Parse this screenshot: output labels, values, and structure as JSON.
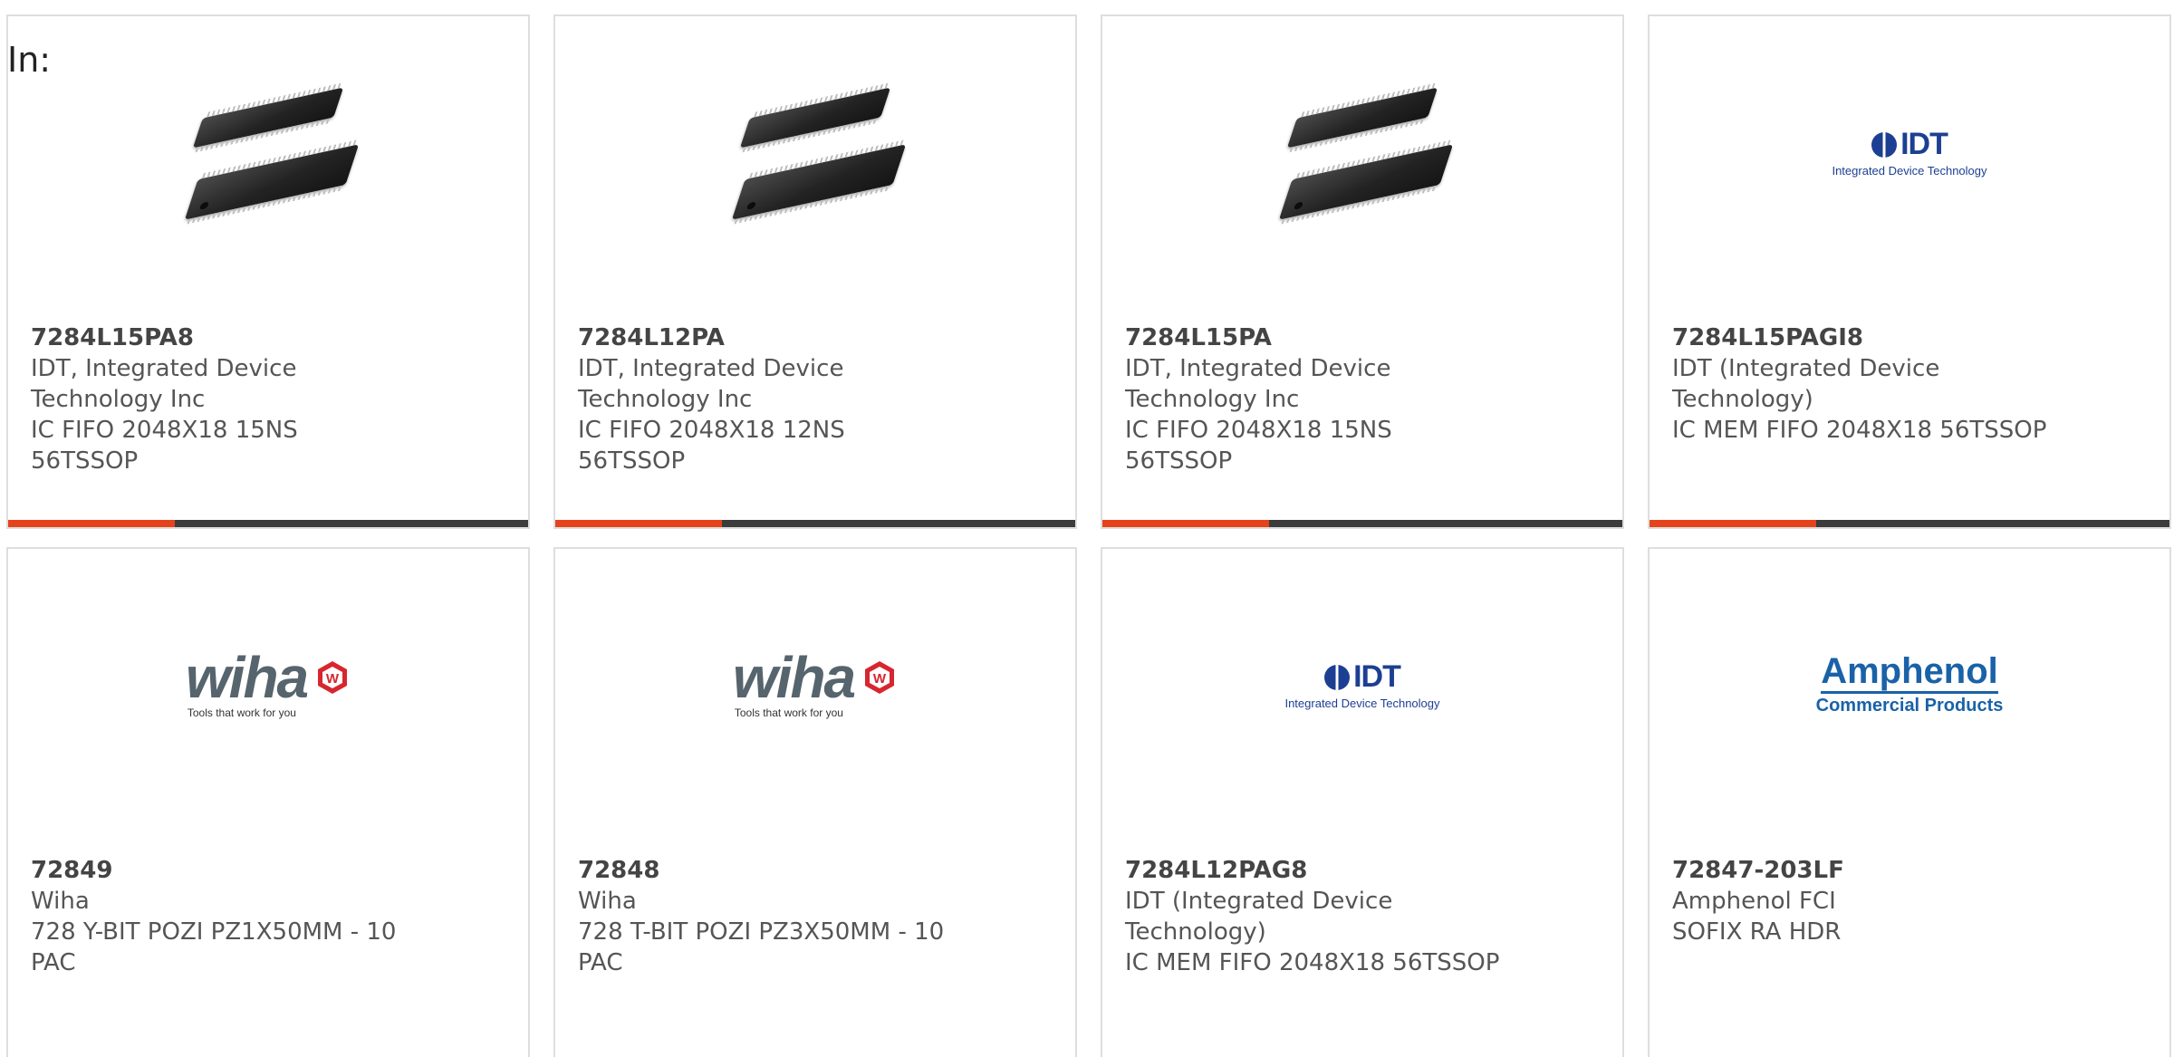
{
  "page": {
    "in_label": "In:"
  },
  "colors": {
    "accent": "#e5431b",
    "bar": "#3c3c3c",
    "border": "#dedede",
    "idt_blue": "#1d3f93",
    "amphenol_blue": "#1a62a8",
    "wiha_red": "#d7262f"
  },
  "cards": [
    {
      "part_number": "7284L15PA8",
      "manufacturer_line1": "IDT, Integrated Device",
      "manufacturer_line2": "Technology Inc",
      "description_line1": "IC FIFO 2048X18 15NS 56TSSOP",
      "description_line2": "",
      "image": "chip-image"
    },
    {
      "part_number": "7284L12PA",
      "manufacturer_line1": "IDT, Integrated Device",
      "manufacturer_line2": "Technology Inc",
      "description_line1": "IC FIFO 2048X18 12NS 56TSSOP",
      "description_line2": "",
      "image": "chip-image"
    },
    {
      "part_number": "7284L15PA",
      "manufacturer_line1": "IDT, Integrated Device",
      "manufacturer_line2": "Technology Inc",
      "description_line1": "IC FIFO 2048X18 15NS 56TSSOP",
      "description_line2": "",
      "image": "chip-image"
    },
    {
      "part_number": "7284L15PAGI8",
      "manufacturer_line1": "IDT (Integrated Device",
      "manufacturer_line2": "Technology)",
      "description_line1": "IC MEM FIFO 2048X18 56TSSOP",
      "description_line2": "",
      "image": "idt-logo",
      "logo_text": "IDT",
      "logo_sub": "Integrated Device Technology"
    },
    {
      "part_number": "72849",
      "manufacturer_line1": "Wiha",
      "manufacturer_line2": "",
      "description_line1": "728 Y-BIT POZI PZ1X50MM - 10",
      "description_line2": "PAC",
      "image": "wiha-logo",
      "logo_text": "wiha",
      "logo_sub": "Tools that work for you"
    },
    {
      "part_number": "72848",
      "manufacturer_line1": "Wiha",
      "manufacturer_line2": "",
      "description_line1": "728 T-BIT POZI PZ3X50MM - 10",
      "description_line2": "PAC",
      "image": "wiha-logo",
      "logo_text": "wiha",
      "logo_sub": "Tools that work for you"
    },
    {
      "part_number": "7284L12PAG8",
      "manufacturer_line1": "IDT (Integrated Device",
      "manufacturer_line2": "Technology)",
      "description_line1": "IC MEM FIFO 2048X18 56TSSOP",
      "description_line2": "",
      "image": "idt-logo",
      "logo_text": "IDT",
      "logo_sub": "Integrated Device Technology"
    },
    {
      "part_number": "72847-203LF",
      "manufacturer_line1": "Amphenol FCI",
      "manufacturer_line2": "",
      "description_line1": "SOFIX RA HDR",
      "description_line2": "",
      "image": "amphenol-logo",
      "logo_text": "Amphenol",
      "logo_sub": "Commercial Products"
    }
  ]
}
